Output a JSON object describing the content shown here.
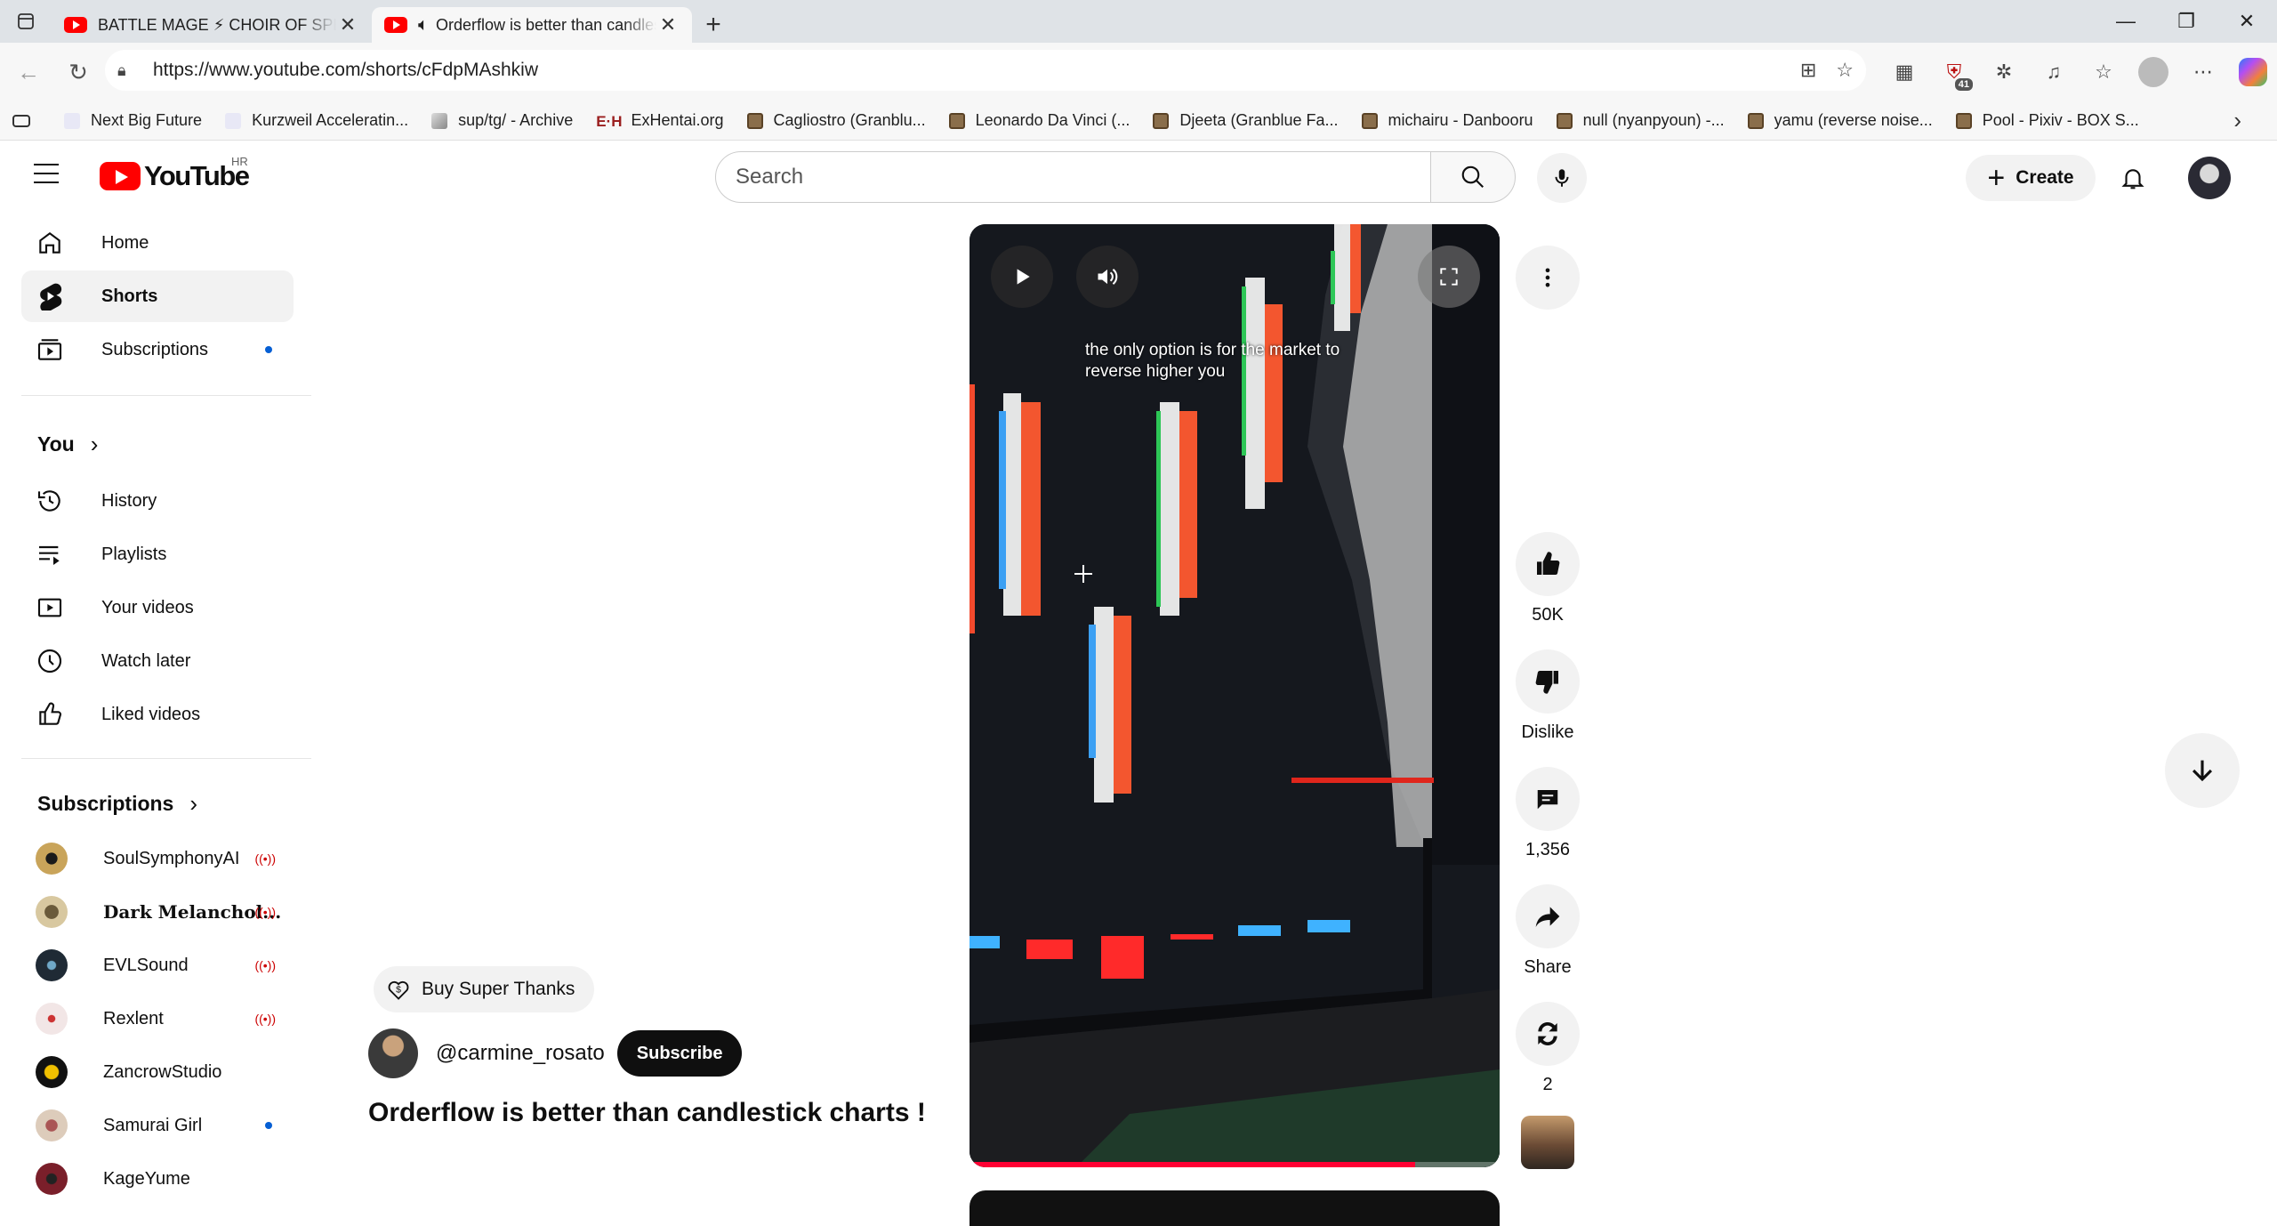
{
  "browser": {
    "tabs": [
      {
        "title": "BATTLE MAGE ⚡ CHOIR OF SPELLS",
        "active": false
      },
      {
        "title": "Orderflow is better than candlestick charts !",
        "active": true
      }
    ],
    "url": "https://www.youtube.com/shorts/cFdpMAshkiw",
    "extension_badge": "41",
    "bookmarks": [
      {
        "label": "Next Big Future",
        "icon": "generic"
      },
      {
        "label": "Kurzweil Acceleratin...",
        "icon": "generic"
      },
      {
        "label": "sup/tg/ - Archive",
        "icon": "picture"
      },
      {
        "label": "ExHentai.org",
        "icon": "eh"
      },
      {
        "label": "Cagliostro (Granblu...",
        "icon": "folder"
      },
      {
        "label": "Leonardo Da Vinci (...",
        "icon": "folder"
      },
      {
        "label": "Djeeta (Granblue Fa...",
        "icon": "folder"
      },
      {
        "label": "michairu - Danbooru",
        "icon": "folder"
      },
      {
        "label": "null (nyanpyoun) -...",
        "icon": "folder"
      },
      {
        "label": "yamu (reverse noise...",
        "icon": "folder"
      },
      {
        "label": "Pool - Pixiv - BOX S...",
        "icon": "folder"
      }
    ]
  },
  "youtube": {
    "logo_text": "YouTube",
    "region": "HR",
    "search_placeholder": "Search",
    "create_label": "Create",
    "sidebar": {
      "main": [
        {
          "label": "Home",
          "icon": "home-icon"
        },
        {
          "label": "Shorts",
          "icon": "shorts-icon",
          "active": true
        },
        {
          "label": "Subscriptions",
          "icon": "subscriptions-icon",
          "dot": true
        }
      ],
      "you_title": "You",
      "you": [
        {
          "label": "History",
          "icon": "history-icon"
        },
        {
          "label": "Playlists",
          "icon": "playlists-icon"
        },
        {
          "label": "Your videos",
          "icon": "your-videos-icon"
        },
        {
          "label": "Watch later",
          "icon": "watch-later-icon"
        },
        {
          "label": "Liked videos",
          "icon": "liked-videos-icon"
        }
      ],
      "subs_title": "Subscriptions",
      "subscriptions": [
        {
          "label": "SoulSymphonyAI",
          "status": "live",
          "color": "#c9a45a"
        },
        {
          "label": "Dark Melanchol...",
          "status": "live",
          "color": "#b8a27a"
        },
        {
          "label": "EVLSound",
          "status": "live",
          "color": "#1f2a35"
        },
        {
          "label": "Rexlent",
          "status": "live",
          "color": "#e9d9d9"
        },
        {
          "label": "ZancrowStudio",
          "status": "none",
          "color": "#e0b000"
        },
        {
          "label": "Samurai Girl",
          "status": "dot",
          "color": "#b77"
        },
        {
          "label": "KageYume",
          "status": "none",
          "color": "#7a1f2a"
        }
      ]
    },
    "short": {
      "caption": "the only option is for the market to reverse higher you",
      "progress": 0.84,
      "super_thanks_label": "Buy Super Thanks",
      "channel": "@carmine_rosato",
      "subscribe_label": "Subscribe",
      "title": "Orderflow is better than candlestick charts !",
      "actions": {
        "likes": "50K",
        "dislike_label": "Dislike",
        "comments": "1,356",
        "share_label": "Share",
        "remix": "2"
      }
    }
  }
}
